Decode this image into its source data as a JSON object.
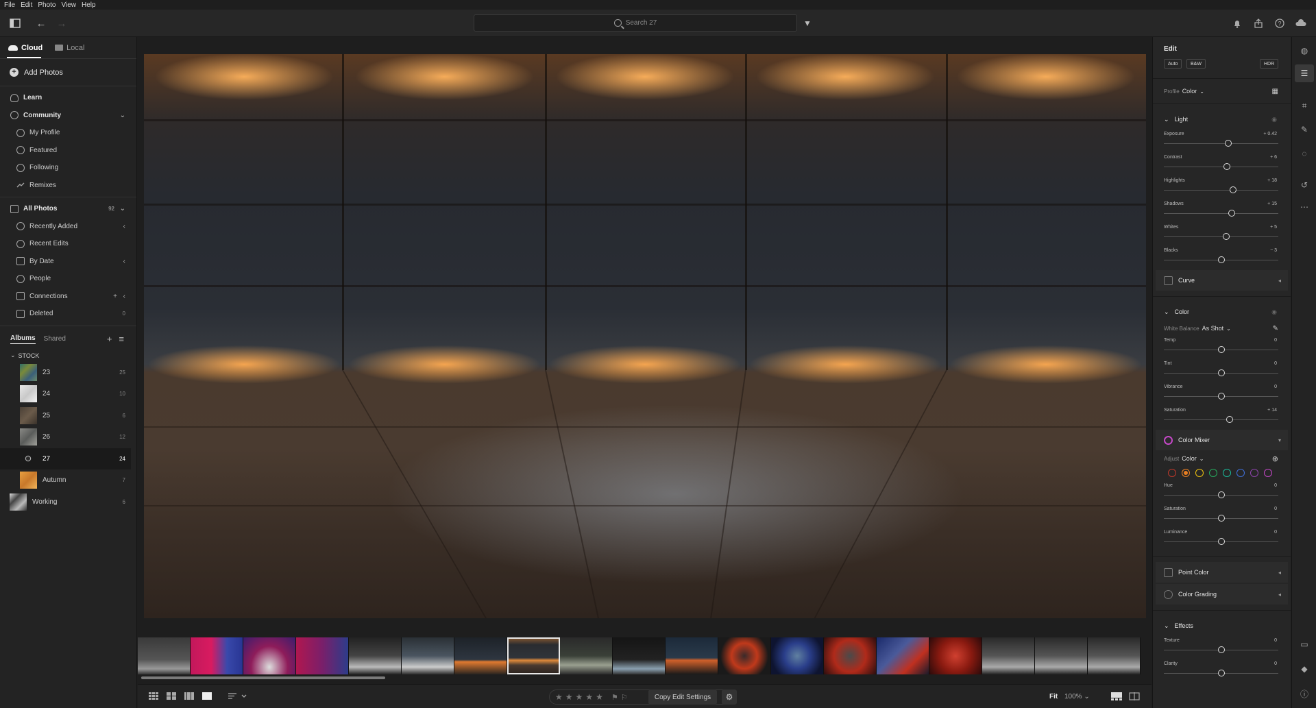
{
  "menu": [
    "File",
    "Edit",
    "Photo",
    "View",
    "Help"
  ],
  "toolbar": {
    "search_placeholder": "Search 27"
  },
  "left": {
    "tabs": {
      "cloud": "Cloud",
      "local": "Local"
    },
    "add_photos": "Add Photos",
    "learn": "Learn",
    "community": "Community",
    "community_items": [
      "My Profile",
      "Featured",
      "Following",
      "Remixes"
    ],
    "all_photos": "All Photos",
    "all_photos_count": "92",
    "photo_items": [
      "Recently Added",
      "Recent Edits",
      "By Date",
      "People",
      "Connections",
      "Deleted"
    ],
    "deleted_count": "0",
    "albums_tab": "Albums",
    "shared_tab": "Shared",
    "group": "STOCK",
    "albums": [
      {
        "name": "23",
        "count": "25"
      },
      {
        "name": "24",
        "count": "10"
      },
      {
        "name": "25",
        "count": "6"
      },
      {
        "name": "26",
        "count": "12"
      },
      {
        "name": "27",
        "count": "24"
      },
      {
        "name": "Autumn",
        "count": "7"
      }
    ],
    "working": {
      "name": "Working",
      "count": "6"
    }
  },
  "bottom": {
    "copy_edit": "Copy Edit Settings",
    "fit": "Fit",
    "zoom": "100%",
    "rating_stars": 5
  },
  "edit": {
    "title": "Edit",
    "auto": "Auto",
    "bw": "B&W",
    "hdr": "HDR",
    "profile_label": "Profile",
    "profile_value": "Color",
    "light_title": "Light",
    "light": [
      {
        "label": "Exposure",
        "value": "+ 0.42",
        "pos": 0.56
      },
      {
        "label": "Contrast",
        "value": "+ 6",
        "pos": 0.55
      },
      {
        "label": "Highlights",
        "value": "+ 18",
        "pos": 0.6
      },
      {
        "label": "Shadows",
        "value": "+ 15",
        "pos": 0.59
      },
      {
        "label": "Whites",
        "value": "+ 5",
        "pos": 0.54
      },
      {
        "label": "Blacks",
        "value": "− 3",
        "pos": 0.5
      }
    ],
    "curve": "Curve",
    "color_title": "Color",
    "wb_label": "White Balance",
    "wb_value": "As Shot",
    "color": [
      {
        "label": "Temp",
        "value": "0",
        "pos": 0.5
      },
      {
        "label": "Tint",
        "value": "0",
        "pos": 0.5
      },
      {
        "label": "Vibrance",
        "value": "0",
        "pos": 0.5
      },
      {
        "label": "Saturation",
        "value": "+ 14",
        "pos": 0.57
      }
    ],
    "color_mixer": "Color Mixer",
    "adjust_label": "Adjust",
    "adjust_value": "Color",
    "swatches": [
      "#c0392b",
      "#e67e22",
      "#f1c40f",
      "#27ae60",
      "#1abc9c",
      "#3f6fd9",
      "#8e44ad",
      "#c548c8"
    ],
    "mixer": [
      {
        "label": "Hue",
        "value": "0",
        "pos": 0.5
      },
      {
        "label": "Saturation",
        "value": "0",
        "pos": 0.5
      },
      {
        "label": "Luminance",
        "value": "0",
        "pos": 0.5
      }
    ],
    "point_color": "Point Color",
    "color_grading": "Color Grading",
    "effects_title": "Effects",
    "effects": [
      {
        "label": "Texture",
        "value": "0",
        "pos": 0.5
      },
      {
        "label": "Clarity",
        "value": "0",
        "pos": 0.5
      }
    ]
  }
}
